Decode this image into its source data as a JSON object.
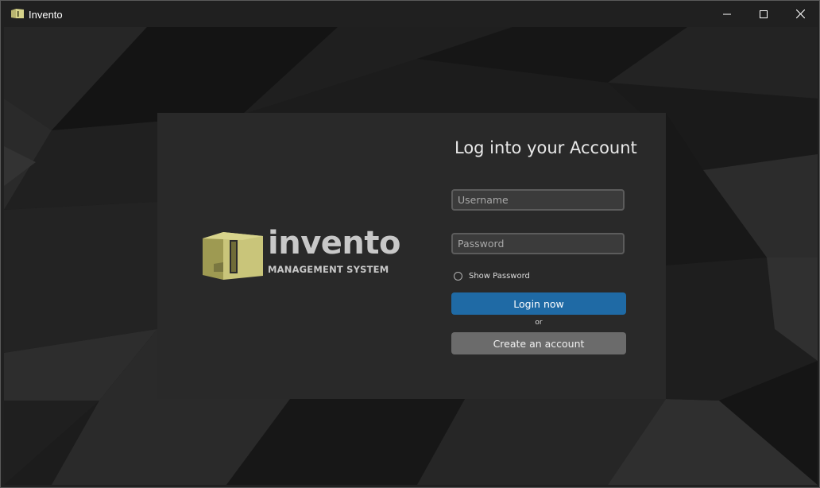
{
  "window": {
    "title": "Invento",
    "icon": "app-logo-icon",
    "controls": [
      "minimize-icon",
      "maximize-icon",
      "close-icon"
    ]
  },
  "logo": {
    "word": "invento",
    "tagline": "MANAGEMENT SYSTEM",
    "color": "#b9b571"
  },
  "form": {
    "title": "Log into your Account",
    "username": {
      "placeholder": "Username",
      "value": ""
    },
    "password": {
      "placeholder": "Password",
      "value": ""
    },
    "show_password_label": "Show Password",
    "show_password_checked": false,
    "login_label": "Login now",
    "or_label": "or",
    "create_label": "Create an account"
  },
  "colors": {
    "login_button": "#1f6aa5",
    "create_button": "#6b6b6b",
    "card": "#292929",
    "titlebar": "#202020"
  }
}
